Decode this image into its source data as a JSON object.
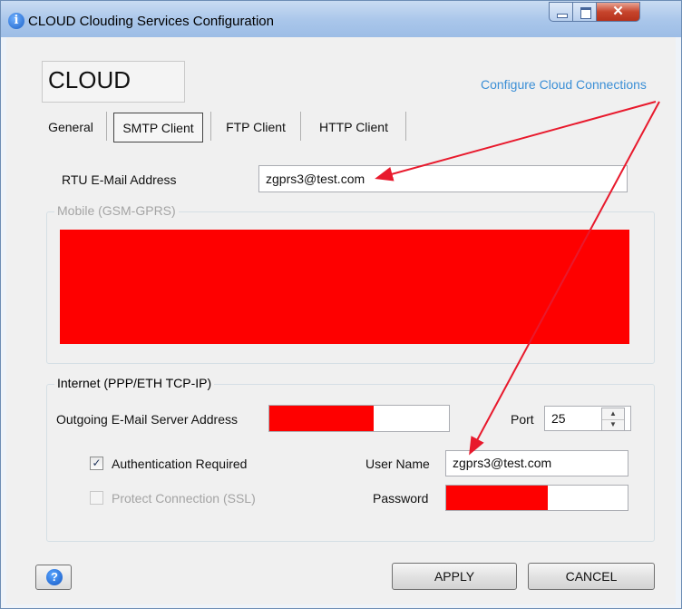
{
  "window": {
    "title": "CLOUD Clouding Services Configuration",
    "title_icon": "info-icon",
    "buttons": [
      "minimize-icon",
      "maximize-icon",
      "close-icon"
    ]
  },
  "header": {
    "logo_text": "CLOUD",
    "configure_link": "Configure Cloud Connections"
  },
  "tabs": [
    {
      "label": "General",
      "active": false
    },
    {
      "label": "SMTP Client",
      "active": true
    },
    {
      "label": "FTP Client",
      "active": false
    },
    {
      "label": "HTTP Client",
      "active": false
    }
  ],
  "smtp": {
    "rtu_email_label": "RTU E-Mail Address",
    "rtu_email_value": "zgprs3@test.com",
    "mobile_group_label": "Mobile (GSM-GPRS)",
    "internet_group_label": "Internet (PPP/ETH TCP-IP)",
    "server_label": "Outgoing E-Mail Server Address",
    "port_label": "Port",
    "port_value": "25",
    "auth_label": "Authentication Required",
    "auth_checked": true,
    "ssl_label": "Protect Connection (SSL)",
    "ssl_checked": false,
    "username_label": "User Name",
    "username_value": "zgprs3@test.com",
    "password_label": "Password"
  },
  "footer": {
    "help_icon": "help-icon",
    "apply_label": "APPLY",
    "cancel_label": "CANCEL"
  },
  "colors": {
    "redaction": "#fe0000",
    "link": "#3b8fd6",
    "annotation_arrow": "#e8192c"
  }
}
